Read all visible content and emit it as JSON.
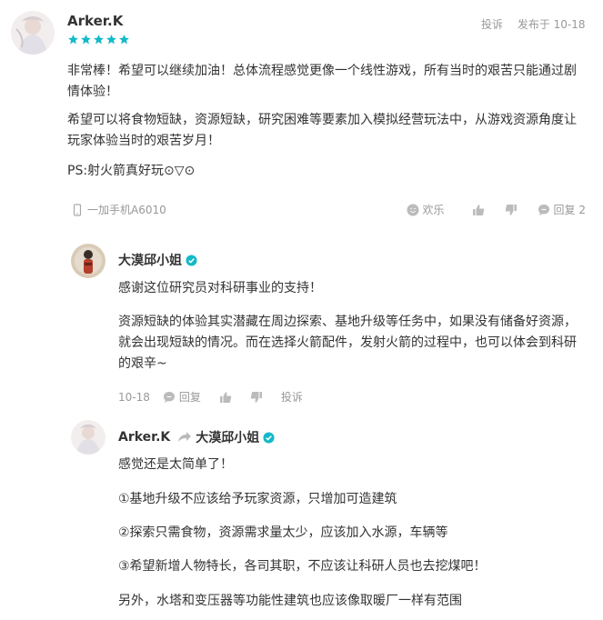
{
  "review": {
    "username": "Arker.K",
    "report_label": "投诉",
    "published": "发布于 10-18",
    "rating": 5,
    "paragraphs": [
      "非常棒！希望可以继续加油！总体流程感觉更像一个线性游戏，所有当时的艰苦只能通过剧情体验！",
      "希望可以将食物短缺，资源短缺，研究困难等要素加入模拟经营玩法中，从游戏资源角度让玩家体验当时的艰苦岁月！",
      "PS:射火箭真好玩⊙▽⊙"
    ],
    "device": "一加手机A6010",
    "happy_label": "欢乐",
    "reply_label": "回复 2"
  },
  "reply1": {
    "username": "大漠邱小姐",
    "paragraphs": [
      "感谢这位研究员对科研事业的支持！",
      "资源短缺的体验其实潜藏在周边探索、基地升级等任务中，如果没有储备好资源，就会出现短缺的情况。而在选择火箭配件，发射火箭的过程中，也可以体会到科研的艰辛~"
    ],
    "date": "10-18",
    "reply_label": "回复",
    "report_label": "投诉"
  },
  "reply2": {
    "username": "Arker.K",
    "target": "大漠邱小姐",
    "paragraphs": [
      "感觉还是太简单了！",
      "①基地升级不应该给予玩家资源，只增加可造建筑",
      "②探索只需食物，资源需求量太少，应该加入水源，车辆等",
      "③希望新增人物特长，各司其职，不应该让科研人员也去挖煤吧！",
      "另外，水塔和变压器等功能性建筑也应该像取暖厂一样有范围"
    ]
  },
  "colors": {
    "star": "#14b9c8",
    "verified": "#14b9c8",
    "meta": "#999999"
  }
}
